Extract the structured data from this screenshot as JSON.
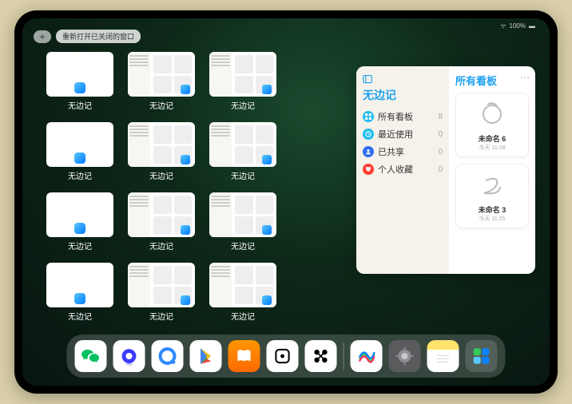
{
  "status": {
    "wifi": "wifi-icon",
    "battery": "100%"
  },
  "topbar": {
    "plus": "+",
    "reopen_label": "重新打开已关闭的窗口"
  },
  "thumbnails": {
    "label": "无边记",
    "items": [
      {
        "variant": "plain"
      },
      {
        "variant": "detail"
      },
      {
        "variant": "detail"
      },
      null,
      {
        "variant": "plain"
      },
      {
        "variant": "detail"
      },
      {
        "variant": "detail"
      },
      null,
      {
        "variant": "plain"
      },
      {
        "variant": "detail"
      },
      {
        "variant": "detail"
      },
      null,
      {
        "variant": "plain"
      },
      {
        "variant": "detail"
      },
      {
        "variant": "detail"
      },
      null
    ]
  },
  "panel": {
    "title": "无边记",
    "right_title": "所有看板",
    "ellipsis": "...",
    "menu": [
      {
        "icon": "grid",
        "color": "#1fbef0",
        "label": "所有看板",
        "count": "8"
      },
      {
        "icon": "clock",
        "color": "#1fbef0",
        "label": "最近使用",
        "count": "0"
      },
      {
        "icon": "share",
        "color": "#2f6df0",
        "label": "已共享",
        "count": "0"
      },
      {
        "icon": "heart",
        "color": "#ff3b30",
        "label": "个人收藏",
        "count": "0"
      }
    ],
    "cards": [
      {
        "scribble": "6",
        "name": "未命名 6",
        "sub": "今天 11:28"
      },
      {
        "scribble": "3",
        "name": "未命名 3",
        "sub": "今天 11:25"
      }
    ]
  },
  "dock": {
    "apps": [
      {
        "name": "wechat",
        "bg": "#fff"
      },
      {
        "name": "quark",
        "bg": "#fff"
      },
      {
        "name": "browser-q",
        "bg": "#fff"
      },
      {
        "name": "play-store",
        "bg": "#fff"
      },
      {
        "name": "books",
        "bg": "linear-gradient(#ff9500,#ff6a00)"
      },
      {
        "name": "dice",
        "bg": "#fff"
      },
      {
        "name": "connect",
        "bg": "#fff"
      }
    ],
    "recent": [
      {
        "name": "freeform",
        "bg": "#fff"
      },
      {
        "name": "settings",
        "bg": "#5b5b5e"
      },
      {
        "name": "notes",
        "bg": "linear-gradient(#ffe36b 33%,#fff 33%)"
      },
      {
        "name": "app-library",
        "bg": "rgba(255,255,255,0.15)"
      }
    ]
  }
}
